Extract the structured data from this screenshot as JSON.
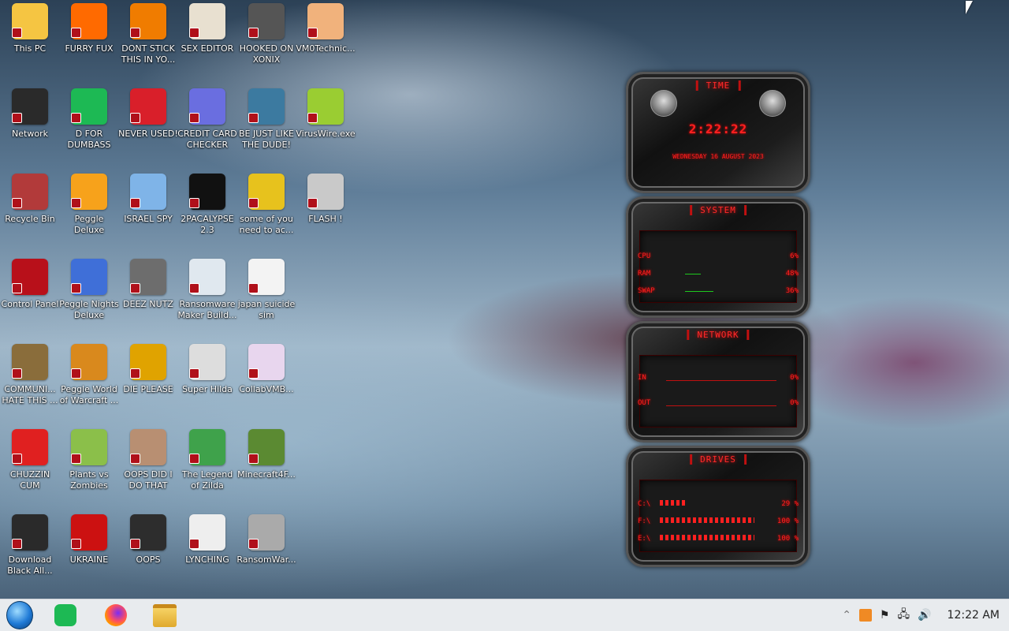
{
  "desktop": {
    "icons": [
      {
        "label": "This PC",
        "color": "#f5c542"
      },
      {
        "label": "FURRY FUX",
        "color": "#ff6a00"
      },
      {
        "label": "DONT STICK THIS IN YO...",
        "color": "#f07c00"
      },
      {
        "label": "SEX EDITOR",
        "color": "#e8e0d0"
      },
      {
        "label": "HOOKED ON XONIX",
        "color": "#555"
      },
      {
        "label": "VM0Technic...",
        "color": "#f1b27c"
      },
      {
        "label": "Network",
        "color": "#2a2a2a"
      },
      {
        "label": "D FOR DUMBASS",
        "color": "#1db954"
      },
      {
        "label": "NEVER USED!",
        "color": "#d91f2a"
      },
      {
        "label": "CREDIT CARD CHECKER",
        "color": "#6a6ee0"
      },
      {
        "label": "BE JUST LIKE THE DUDE!",
        "color": "#3c7aa0"
      },
      {
        "label": "VirusWire.exe",
        "color": "#9acd32"
      },
      {
        "label": "Recycle Bin",
        "color": "#b23a3a"
      },
      {
        "label": "Peggle Deluxe",
        "color": "#f7a21b"
      },
      {
        "label": "ISRAEL SPY",
        "color": "#7fb4e8"
      },
      {
        "label": "2PACALYPSE 2.3",
        "color": "#111"
      },
      {
        "label": "some of you need to ac...",
        "color": "#e7c21d"
      },
      {
        "label": "FLASH !",
        "color": "#c9c9c9"
      },
      {
        "label": "Control Panel",
        "color": "#b8101a"
      },
      {
        "label": "Peggle Nights Deluxe",
        "color": "#3f6fd8"
      },
      {
        "label": "DEEZ NUTZ",
        "color": "#6d6d6d"
      },
      {
        "label": "Ransomware Maker Build...",
        "color": "#e0e8ef"
      },
      {
        "label": "japan suicide sim",
        "color": "#f3f3f3"
      },
      {
        "label": "COMMUNI... HATE THIS ...",
        "color": "#8a6d3b"
      },
      {
        "label": "Peggle World of Warcraft ...",
        "color": "#d9891d"
      },
      {
        "label": "DIE PLEASE",
        "color": "#e0a300"
      },
      {
        "label": "Super Hilda",
        "color": "#ddd"
      },
      {
        "label": "CollabVMB...",
        "color": "#e8d6ee"
      },
      {
        "label": "CHUZZIN CUM",
        "color": "#e02020"
      },
      {
        "label": "Plants vs Zombies",
        "color": "#8bbf4a"
      },
      {
        "label": "OOPS DID I DO THAT",
        "color": "#b88f72"
      },
      {
        "label": "The Legend of Zilda",
        "color": "#3fa24b"
      },
      {
        "label": "Minecraft4F...",
        "color": "#5b8a32"
      },
      {
        "label": "Download Black All...",
        "color": "#2a2a2a"
      },
      {
        "label": "UKRAINE",
        "color": "#cc1111"
      },
      {
        "label": "OOPS",
        "color": "#2d2d2d"
      },
      {
        "label": "LYNCHING",
        "color": "#eeeeee"
      },
      {
        "label": "RansomWar...",
        "color": "#aaaaaa"
      }
    ]
  },
  "widget": {
    "time_title": "TIME",
    "clock": "2:22:22",
    "date": "WEDNESDAY 16 AUGUST 2023",
    "system_title": "SYSTEM",
    "system": [
      {
        "label": "CPU",
        "value": "6%"
      },
      {
        "label": "RAM",
        "value": "48%"
      },
      {
        "label": "SWAP",
        "value": "36%"
      }
    ],
    "network_title": "NETWORK",
    "network": [
      {
        "label": "IN",
        "value": "0%"
      },
      {
        "label": "OUT",
        "value": "0%"
      }
    ],
    "drives_title": "DRIVES",
    "drives": [
      {
        "label": "C:\\",
        "value": "29 %",
        "fill": 0.29
      },
      {
        "label": "F:\\",
        "value": "100 %",
        "fill": 1.0
      },
      {
        "label": "E:\\",
        "value": "100 %",
        "fill": 1.0
      }
    ]
  },
  "taskbar": {
    "clock": "12:22 AM"
  }
}
